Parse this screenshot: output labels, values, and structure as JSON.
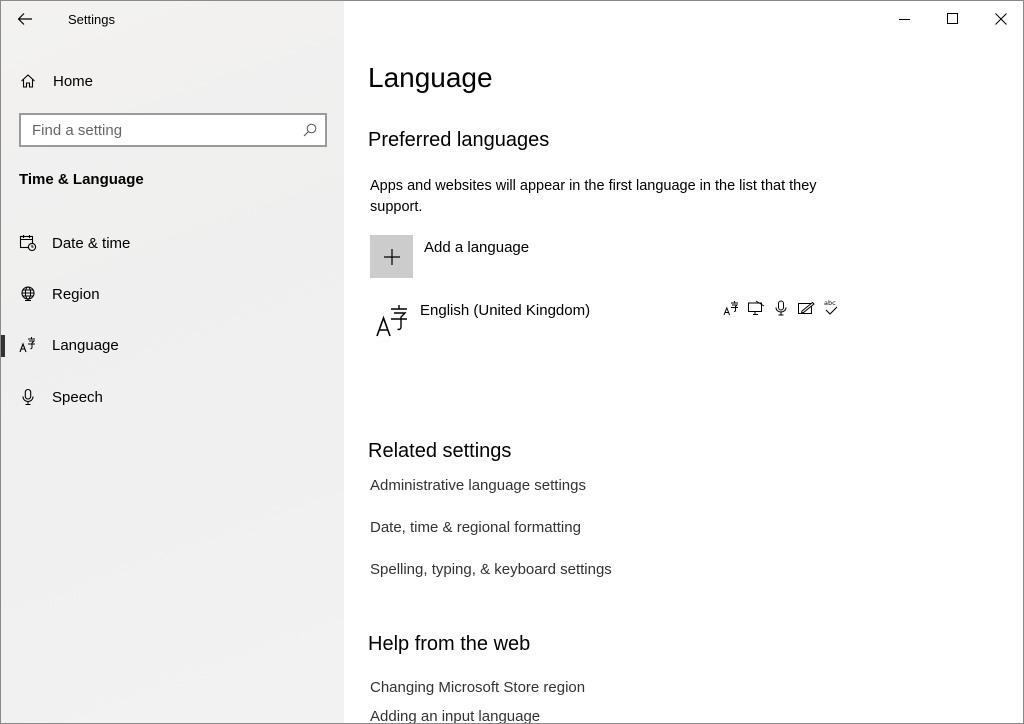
{
  "window": {
    "title": "Settings"
  },
  "sidebar": {
    "home_label": "Home",
    "search_placeholder": "Find a setting",
    "section_title": "Time & Language",
    "items": [
      {
        "label": "Date & time",
        "icon": "calendar-clock-icon"
      },
      {
        "label": "Region",
        "icon": "globe-icon"
      },
      {
        "label": "Language",
        "icon": "language-icon",
        "active": true
      },
      {
        "label": "Speech",
        "icon": "microphone-icon"
      }
    ]
  },
  "main": {
    "title": "Language",
    "preferred": {
      "heading": "Preferred languages",
      "description": "Apps and websites will appear in the first language in the list that they support.",
      "add_label": "Add a language",
      "languages": [
        {
          "name": "English (United Kingdom)",
          "features": [
            "language-pack-icon",
            "display-language-icon",
            "speech-icon",
            "handwriting-icon",
            "spell-check-icon"
          ]
        }
      ]
    },
    "related": {
      "heading": "Related settings",
      "links": [
        "Administrative language settings",
        "Date, time & regional formatting",
        "Spelling, typing, & keyboard settings"
      ]
    },
    "help": {
      "heading": "Help from the web",
      "links": [
        "Changing Microsoft Store region",
        "Adding an input language"
      ]
    }
  },
  "colors": {
    "sidebar_bg": "#f2f2f2",
    "add_button_bg": "#cccccc",
    "active_indicator": "#333333"
  }
}
